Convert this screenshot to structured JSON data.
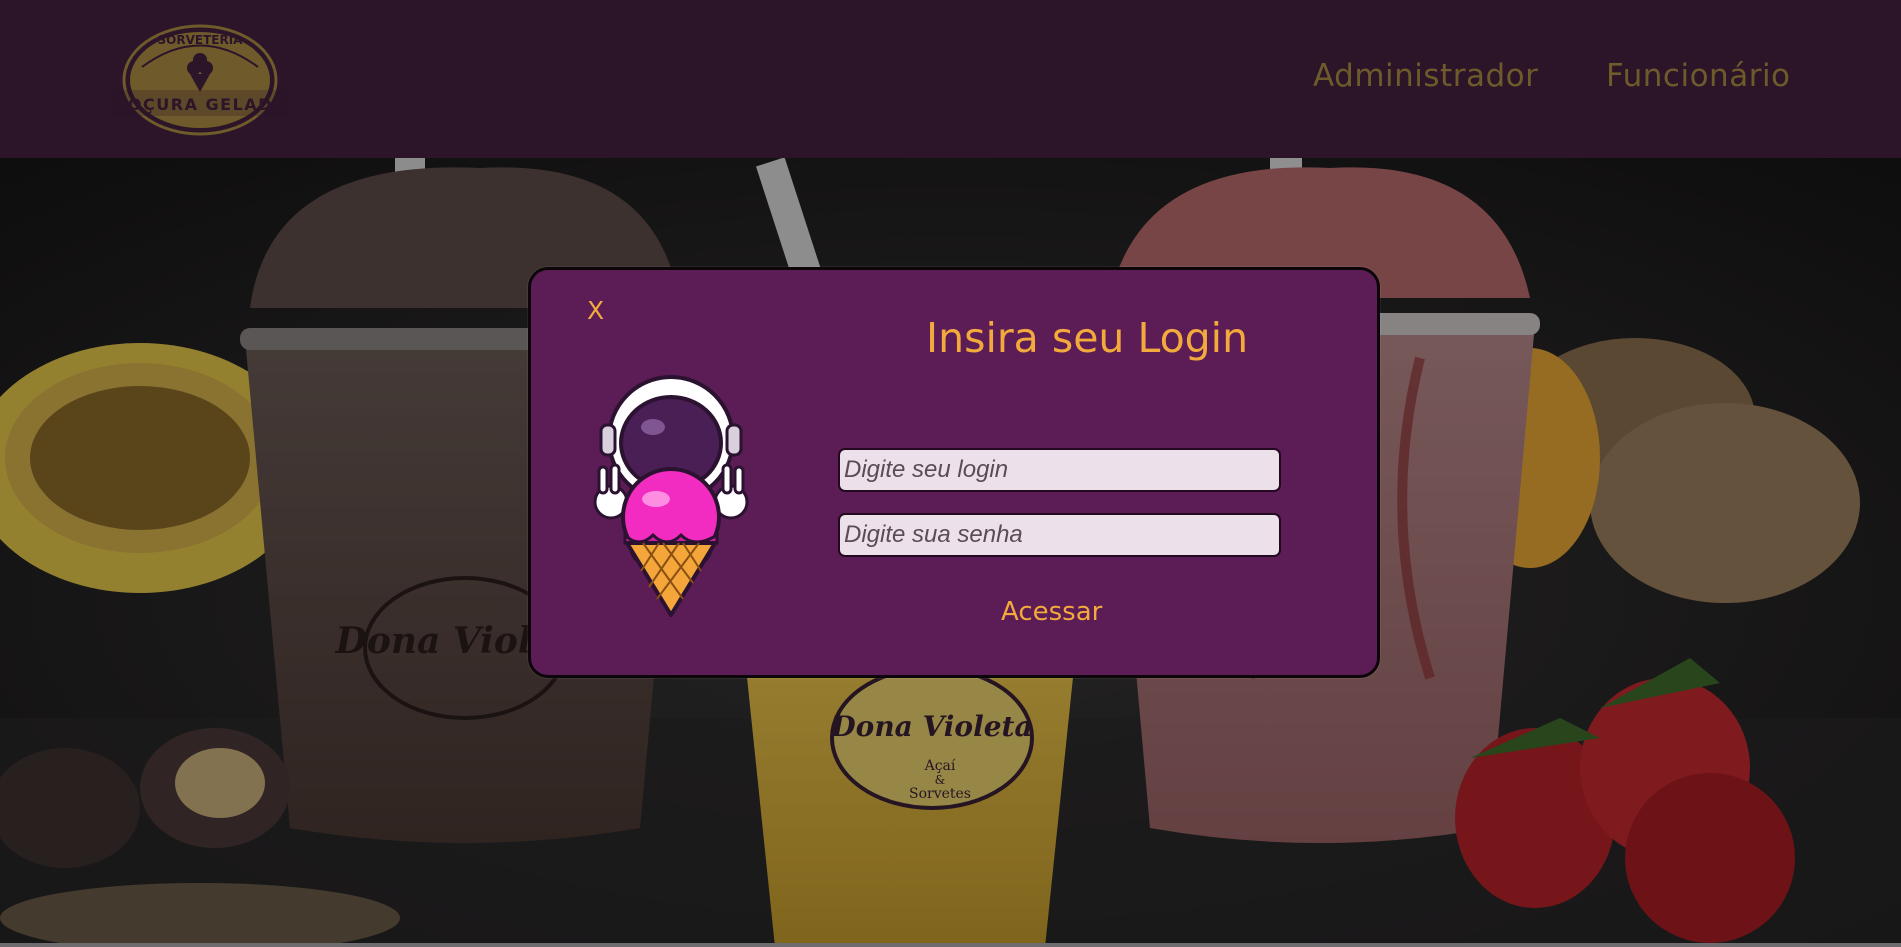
{
  "brand": {
    "logo_top_text": "SORVETERIA",
    "logo_bottom_text": "DOÇURA GELADA",
    "logo_color": "#6e5a2a"
  },
  "nav": {
    "items": [
      {
        "label": "Administrador"
      },
      {
        "label": "Funcionário"
      }
    ]
  },
  "hero": {
    "cup_brand": "Dona Violeta",
    "cup_sub_1": "Açaí",
    "cup_sub_2": "&",
    "cup_sub_3": "Sorvetes"
  },
  "login_modal": {
    "close_label": "X",
    "title": "Insira seu Login",
    "login_placeholder": "Digite seu login",
    "password_placeholder": "Digite sua senha",
    "submit_label": "Acessar",
    "accent_color": "#f2aa3c",
    "background_color": "#5c1c55"
  }
}
